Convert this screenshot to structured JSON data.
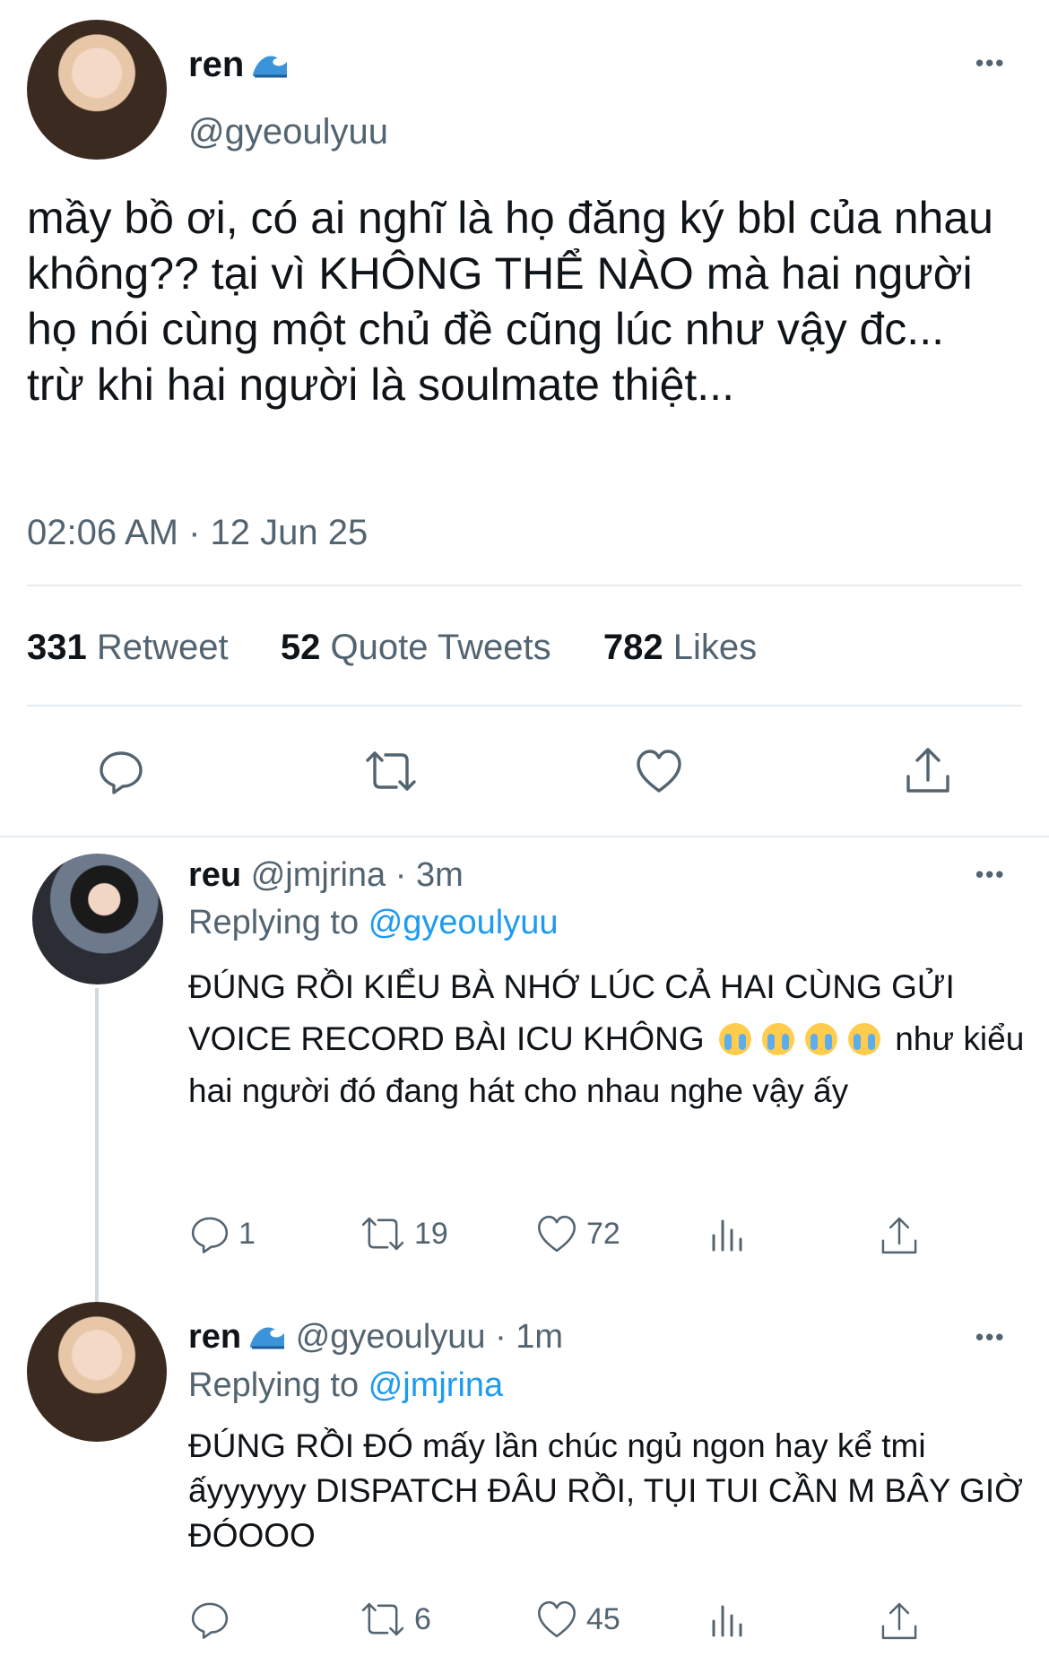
{
  "main_tweet": {
    "name": "ren",
    "handle": "@gyeoulyuu",
    "more": "•••",
    "text": "mầy bồ ơi, có ai nghĩ là họ đăng ký bbl của nhau không?? tại vì KHÔNG THỂ NÀO mà hai người họ nói cùng một chủ đề cũng lúc như vậy đc... trừ khi hai người là soulmate thiệt...",
    "timestamp": "02:06 AM · 12 Jun 25",
    "stats": {
      "retweets_count": "331",
      "retweets_label": "Retweet",
      "quotes_count": "52",
      "quotes_label": "Quote Tweets",
      "likes_count": "782",
      "likes_label": "Likes"
    }
  },
  "replies": [
    {
      "name": "reu",
      "handle_time": "@jmjrina · 3m",
      "replying_label": "Replying to",
      "replying_to": "@gyeoulyuu",
      "text_part1": "ĐÚNG RỒI KIỂU BÀ NHỚ LÚC CẢ HAI CÙNG GỬI VOICE RECORD BÀI ICU KHÔNG",
      "text_part2": "như kiểu hai người đó đang hát cho nhau nghe vậy ấy",
      "emoji": "loudly-crying-face",
      "replies_count": "1",
      "retweets_count": "19",
      "likes_count": "72",
      "more": "•••"
    },
    {
      "name": "ren",
      "handle_time": "@gyeoulyuu · 1m",
      "replying_label": "Replying to",
      "replying_to": "@jmjrina",
      "text": "ĐÚNG RỒI ĐÓ mấy lần chúc ngủ ngon hay kể tmi ấyyyyyy DISPATCH ĐÂU RỒI, TỤI TUI CẦN M BÂY GIỜ ĐÓOOO",
      "replies_count": "",
      "retweets_count": "6",
      "likes_count": "45",
      "more": "•••"
    }
  ],
  "colors": {
    "link": "#1d9bf0",
    "secondary": "#536471",
    "divider": "#e6ecf0"
  }
}
